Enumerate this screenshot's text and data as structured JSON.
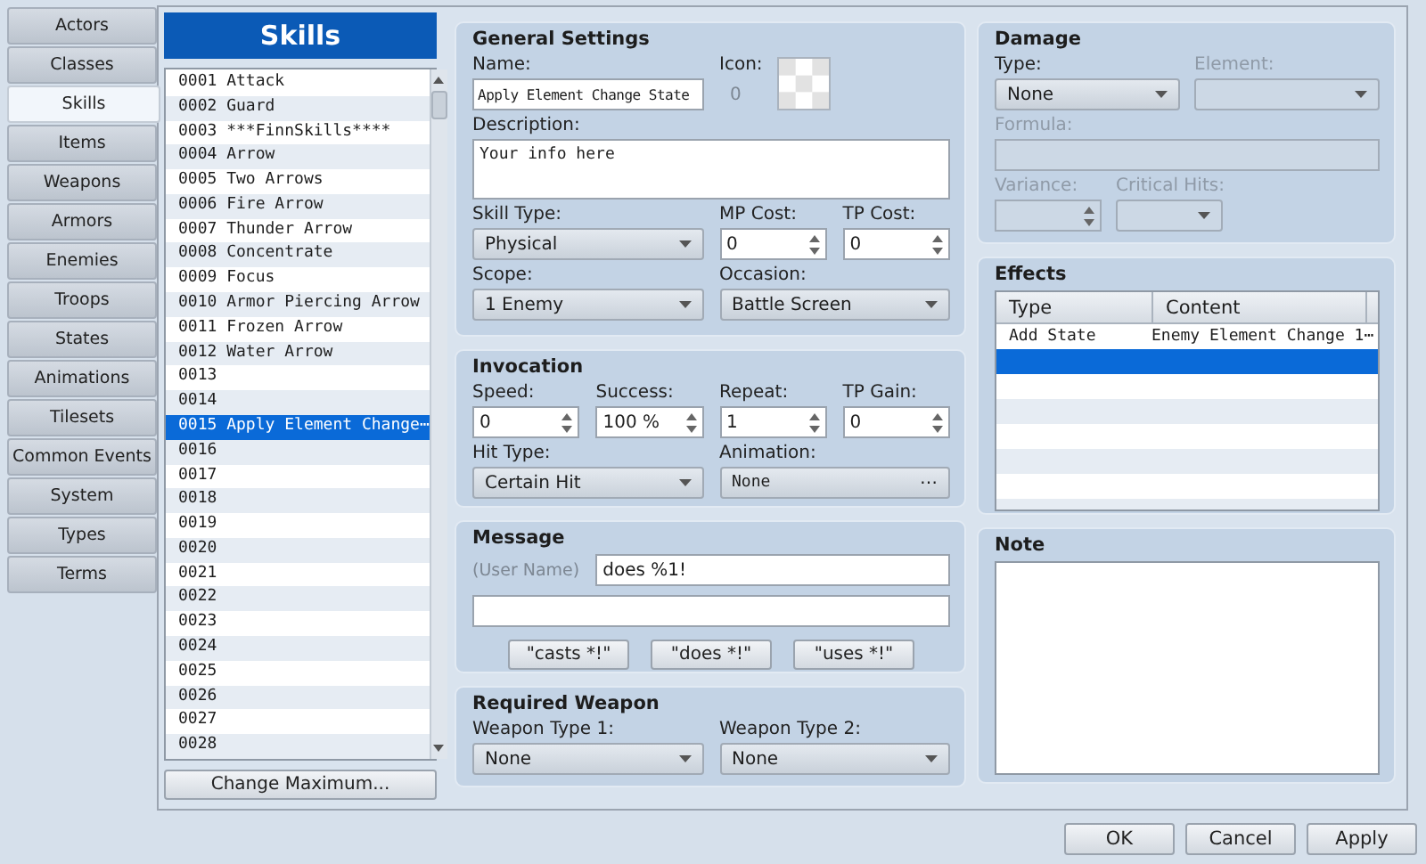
{
  "tabs": [
    {
      "label": "Actors",
      "selected": false
    },
    {
      "label": "Classes",
      "selected": false
    },
    {
      "label": "Skills",
      "selected": true
    },
    {
      "label": "Items",
      "selected": false
    },
    {
      "label": "Weapons",
      "selected": false
    },
    {
      "label": "Armors",
      "selected": false
    },
    {
      "label": "Enemies",
      "selected": false
    },
    {
      "label": "Troops",
      "selected": false
    },
    {
      "label": "States",
      "selected": false
    },
    {
      "label": "Animations",
      "selected": false
    },
    {
      "label": "Tilesets",
      "selected": false
    },
    {
      "label": "Common Events",
      "selected": false
    },
    {
      "label": "System",
      "selected": false
    },
    {
      "label": "Types",
      "selected": false
    },
    {
      "label": "Terms",
      "selected": false
    }
  ],
  "list": {
    "title": "Skills",
    "button": "Change Maximum...",
    "items": [
      {
        "label": "0001 Attack",
        "selected": false
      },
      {
        "label": "0002 Guard",
        "selected": false
      },
      {
        "label": "0003 ***FinnSkills****",
        "selected": false
      },
      {
        "label": "0004 Arrow",
        "selected": false
      },
      {
        "label": "0005 Two Arrows",
        "selected": false
      },
      {
        "label": "0006 Fire Arrow",
        "selected": false
      },
      {
        "label": "0007 Thunder Arrow",
        "selected": false
      },
      {
        "label": "0008 Concentrate",
        "selected": false
      },
      {
        "label": "0009 Focus",
        "selected": false
      },
      {
        "label": "0010 Armor Piercing Arrow",
        "selected": false
      },
      {
        "label": "0011 Frozen Arrow",
        "selected": false
      },
      {
        "label": "0012 Water Arrow",
        "selected": false
      },
      {
        "label": "0013",
        "selected": false
      },
      {
        "label": "0014",
        "selected": false
      },
      {
        "label": "0015 Apply Element Change⋯",
        "selected": true
      },
      {
        "label": "0016",
        "selected": false
      },
      {
        "label": "0017",
        "selected": false
      },
      {
        "label": "0018",
        "selected": false
      },
      {
        "label": "0019",
        "selected": false
      },
      {
        "label": "0020",
        "selected": false
      },
      {
        "label": "0021",
        "selected": false
      },
      {
        "label": "0022",
        "selected": false
      },
      {
        "label": "0023",
        "selected": false
      },
      {
        "label": "0024",
        "selected": false
      },
      {
        "label": "0025",
        "selected": false
      },
      {
        "label": "0026",
        "selected": false
      },
      {
        "label": "0027",
        "selected": false
      },
      {
        "label": "0028",
        "selected": false
      }
    ]
  },
  "general": {
    "title": "General Settings",
    "name": {
      "label": "Name:",
      "kind": "text",
      "value": "Apply Element Change State"
    },
    "icon": {
      "label": "Icon:",
      "index": "0"
    },
    "description": {
      "label": "Description:",
      "kind": "textarea",
      "value": "Your info here"
    },
    "skill_type": {
      "label": "Skill Type:",
      "kind": "select",
      "value": "Physical"
    },
    "mp_cost": {
      "label": "MP Cost:",
      "kind": "spin",
      "value": "0"
    },
    "tp_cost": {
      "label": "TP Cost:",
      "kind": "spin",
      "value": "0"
    },
    "scope": {
      "label": "Scope:",
      "kind": "select",
      "value": "1 Enemy"
    },
    "occasion": {
      "label": "Occasion:",
      "kind": "select",
      "value": "Battle Screen"
    }
  },
  "invocation": {
    "title": "Invocation",
    "speed": {
      "label": "Speed:",
      "kind": "spin",
      "value": "0"
    },
    "success": {
      "label": "Success:",
      "kind": "spin",
      "value": "100 %"
    },
    "repeat": {
      "label": "Repeat:",
      "kind": "spin",
      "value": "1"
    },
    "tp_gain": {
      "label": "TP Gain:",
      "kind": "spin",
      "value": "0"
    },
    "hit_type": {
      "label": "Hit Type:",
      "kind": "select",
      "value": "Certain Hit"
    },
    "animation": {
      "label": "Animation:",
      "kind": "picker",
      "value": "None",
      "button": "⋯"
    }
  },
  "message": {
    "title": "Message",
    "user_label": "(User Name)",
    "line_1": "does %1!",
    "presets": [
      "\"casts *!\"",
      "\"does *!\"",
      "\"uses *!\""
    ]
  },
  "required_weapon": {
    "title": "Required Weapon",
    "weapon_type_1": {
      "label": "Weapon Type 1:",
      "kind": "select",
      "value": "None"
    },
    "weapon_type_2": {
      "label": "Weapon Type 2:",
      "kind": "select",
      "value": "None"
    }
  },
  "damage": {
    "title": "Damage",
    "type": {
      "label": "Type:",
      "kind": "select",
      "value": "None",
      "disabled": false
    },
    "element": {
      "label": "Element:",
      "kind": "select",
      "disabled": true
    },
    "formula": {
      "label": "Formula:",
      "kind": "text",
      "disabled": true
    },
    "variance": {
      "label": "Variance:",
      "kind": "spin",
      "disabled": true
    },
    "critical_hits": {
      "label": "Critical Hits:",
      "kind": "select",
      "disabled": true
    }
  },
  "effects": {
    "title": "Effects",
    "columns": [
      "Type",
      "Content"
    ],
    "rows": [
      {
        "type": "Add State",
        "content": "Enemy Element Change 1⋯",
        "selected": false
      },
      {
        "selected": true
      }
    ]
  },
  "note": {
    "title": "Note"
  },
  "buttons": [
    "OK",
    "Cancel",
    "Apply"
  ]
}
